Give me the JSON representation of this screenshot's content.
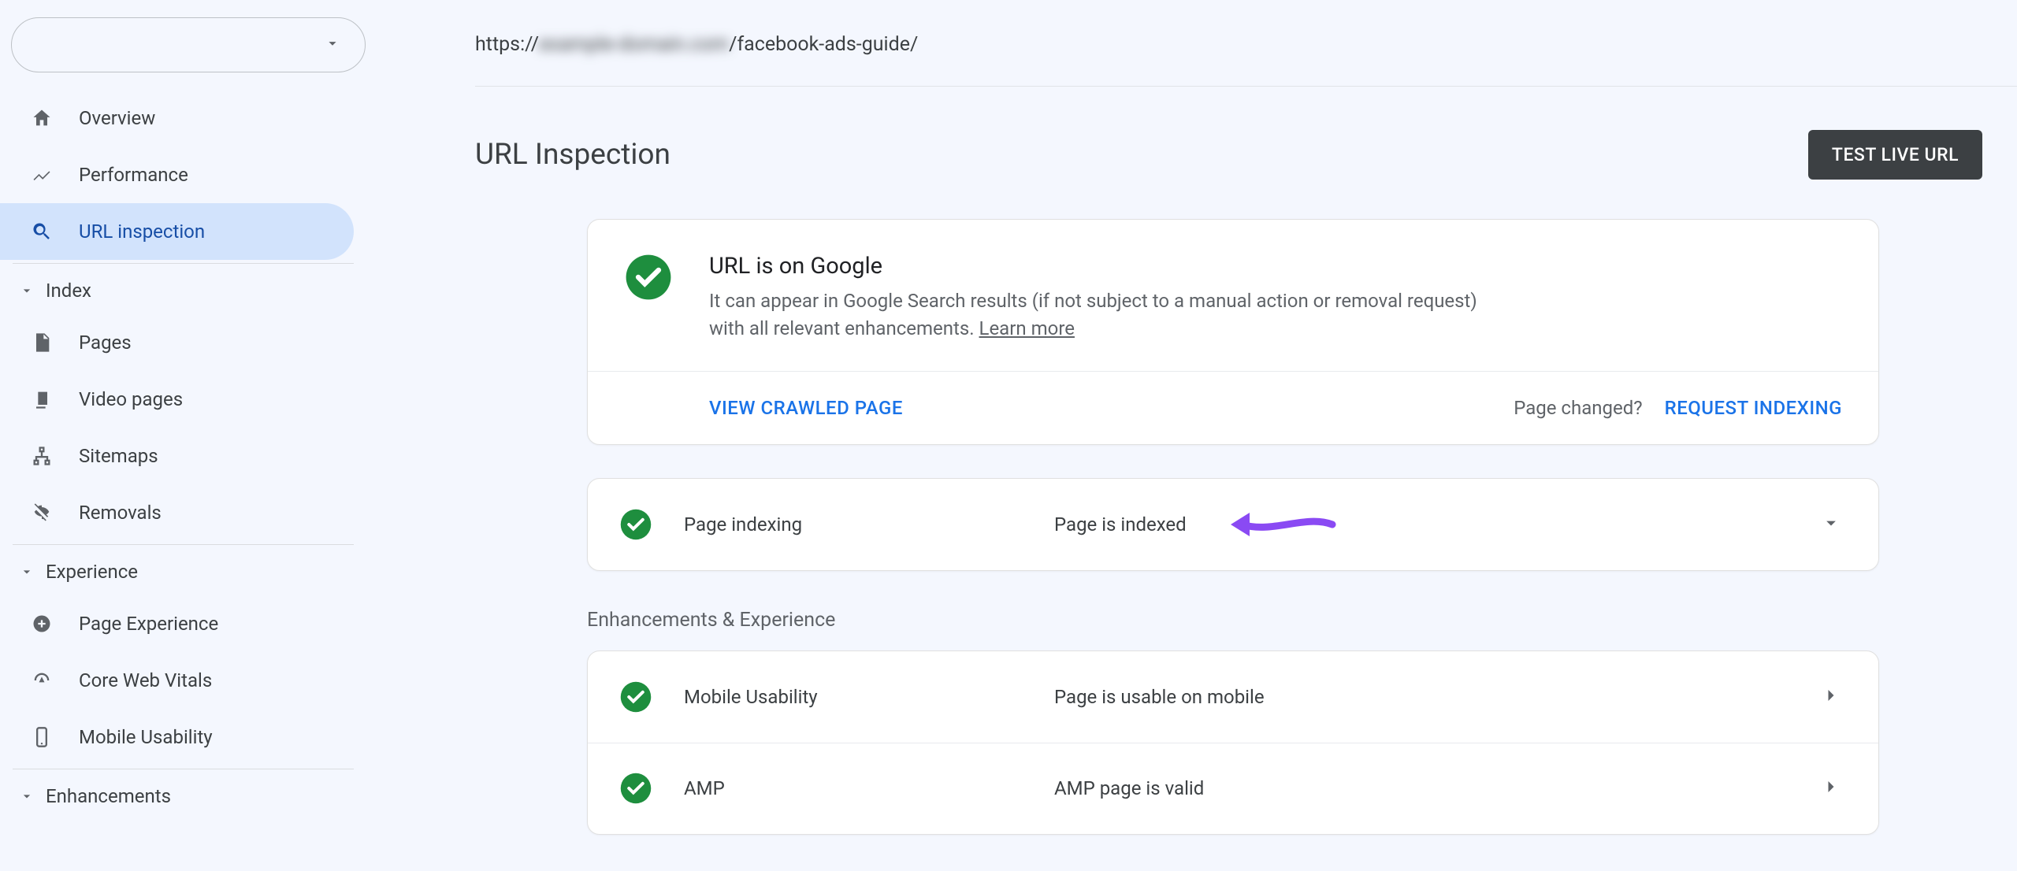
{
  "sidebar": {
    "property_value": "",
    "nav": {
      "overview": "Overview",
      "performance": "Performance",
      "url_inspection": "URL inspection"
    },
    "index_section": {
      "title": "Index",
      "pages": "Pages",
      "video_pages": "Video pages",
      "sitemaps": "Sitemaps",
      "removals": "Removals"
    },
    "experience_section": {
      "title": "Experience",
      "page_experience": "Page Experience",
      "core_web_vitals": "Core Web Vitals",
      "mobile_usability": "Mobile Usability"
    },
    "enhancements_section": {
      "title": "Enhancements"
    }
  },
  "url_bar": {
    "prefix": "https://",
    "blurred": "example-domain.com",
    "suffix": "/facebook-ads-guide/"
  },
  "heading": {
    "title": "URL Inspection",
    "test_live": "TEST LIVE URL"
  },
  "main_card": {
    "title": "URL is on Google",
    "desc": "It can appear in Google Search results (if not subject to a manual action or removal request) with all relevant enhancements. ",
    "learn_more": "Learn more",
    "view_crawled": "VIEW CRAWLED PAGE",
    "page_changed": "Page changed?",
    "request_indexing": "REQUEST INDEXING"
  },
  "indexing_row": {
    "label": "Page indexing",
    "value": "Page is indexed"
  },
  "enhancements_title": "Enhancements & Experience",
  "rows": {
    "mobile": {
      "label": "Mobile Usability",
      "value": "Page is usable on mobile"
    },
    "amp": {
      "label": "AMP",
      "value": "AMP page is valid"
    }
  },
  "colors": {
    "success": "#1e8e3e",
    "accent_arrow": "#8a4af3"
  }
}
